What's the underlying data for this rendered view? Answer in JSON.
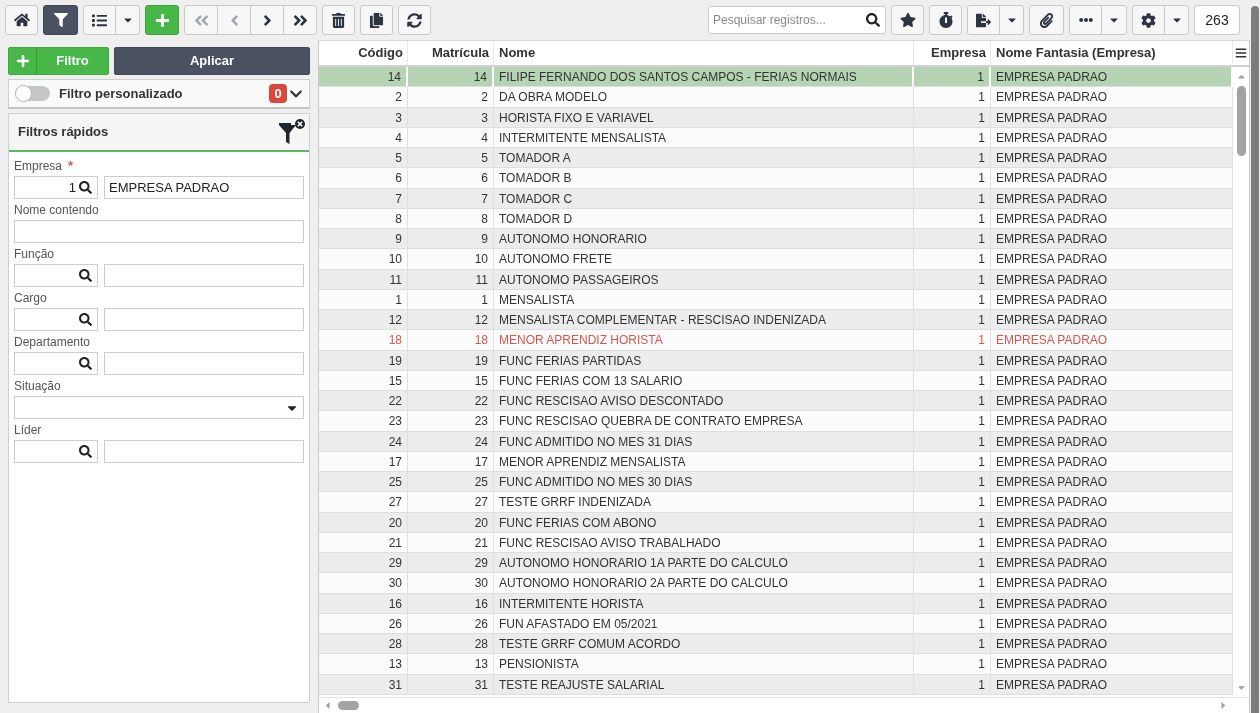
{
  "toolbar": {
    "filter_button": {
      "selected": true
    },
    "navigation": [
      {
        "disabled": true
      },
      {
        "disabled": true
      },
      {
        "disabled": false
      },
      {
        "disabled": false
      }
    ],
    "search": {
      "placeholder": "Pesquisar registros..."
    },
    "record_count": "263"
  },
  "filter_panel": {
    "add_filter_button": "Filtro",
    "apply_button": "Aplicar",
    "custom_filter": {
      "label": "Filtro personalizado",
      "on": false,
      "count": "0"
    },
    "quick_filters": {
      "title": "Filtros rápidos",
      "fields": [
        {
          "kind": "lookup",
          "label": "Empresa",
          "required_mark": "*",
          "code": "1",
          "value": "EMPRESA PADRAO"
        },
        {
          "kind": "text",
          "label": "Nome contendo"
        },
        {
          "kind": "lookup",
          "label": "Função"
        },
        {
          "kind": "lookup",
          "label": "Cargo"
        },
        {
          "kind": "lookup",
          "label": "Departamento"
        },
        {
          "kind": "select",
          "label": "Situação"
        },
        {
          "kind": "lookup",
          "label": "Líder"
        }
      ]
    }
  },
  "table": {
    "columns": [
      "Código",
      "Matrícula",
      "Nome",
      "Empresa",
      "Nome Fantasia (Empresa)"
    ],
    "rows": [
      {
        "cells": [
          "14",
          "14",
          "FILIPE FERNANDO DOS SANTOS CAMPOS - FERIAS NORMAIS",
          "1",
          "EMPRESA PADRAO"
        ],
        "selected": true,
        "flagged": false
      },
      {
        "cells": [
          "2",
          "2",
          "DA OBRA MODELO",
          "1",
          "EMPRESA PADRAO"
        ],
        "selected": false,
        "flagged": false
      },
      {
        "cells": [
          "3",
          "3",
          "HORISTA FIXO E VARIAVEL",
          "1",
          "EMPRESA PADRAO"
        ],
        "selected": false,
        "flagged": false
      },
      {
        "cells": [
          "4",
          "4",
          "INTERMITENTE MENSALISTA",
          "1",
          "EMPRESA PADRAO"
        ],
        "selected": false,
        "flagged": false
      },
      {
        "cells": [
          "5",
          "5",
          "TOMADOR A",
          "1",
          "EMPRESA PADRAO"
        ],
        "selected": false,
        "flagged": false
      },
      {
        "cells": [
          "6",
          "6",
          "TOMADOR B",
          "1",
          "EMPRESA PADRAO"
        ],
        "selected": false,
        "flagged": false
      },
      {
        "cells": [
          "7",
          "7",
          "TOMADOR C",
          "1",
          "EMPRESA PADRAO"
        ],
        "selected": false,
        "flagged": false
      },
      {
        "cells": [
          "8",
          "8",
          "TOMADOR D",
          "1",
          "EMPRESA PADRAO"
        ],
        "selected": false,
        "flagged": false
      },
      {
        "cells": [
          "9",
          "9",
          "AUTONOMO HONORARIO",
          "1",
          "EMPRESA PADRAO"
        ],
        "selected": false,
        "flagged": false
      },
      {
        "cells": [
          "10",
          "10",
          "AUTONOMO FRETE",
          "1",
          "EMPRESA PADRAO"
        ],
        "selected": false,
        "flagged": false
      },
      {
        "cells": [
          "11",
          "11",
          "AUTONOMO PASSAGEIROS",
          "1",
          "EMPRESA PADRAO"
        ],
        "selected": false,
        "flagged": false
      },
      {
        "cells": [
          "1",
          "1",
          "MENSALISTA",
          "1",
          "EMPRESA PADRAO"
        ],
        "selected": false,
        "flagged": false
      },
      {
        "cells": [
          "12",
          "12",
          "MENSALISTA COMPLEMENTAR - RESCISAO INDENIZADA",
          "1",
          "EMPRESA PADRAO"
        ],
        "selected": false,
        "flagged": false
      },
      {
        "cells": [
          "18",
          "18",
          "MENOR APRENDIZ HORISTA",
          "1",
          "EMPRESA PADRAO"
        ],
        "selected": false,
        "flagged": true
      },
      {
        "cells": [
          "19",
          "19",
          "FUNC FERIAS PARTIDAS",
          "1",
          "EMPRESA PADRAO"
        ],
        "selected": false,
        "flagged": false
      },
      {
        "cells": [
          "15",
          "15",
          "FUNC FERIAS COM 13 SALARIO",
          "1",
          "EMPRESA PADRAO"
        ],
        "selected": false,
        "flagged": false
      },
      {
        "cells": [
          "22",
          "22",
          "FUNC RESCISAO AVISO DESCONTADO",
          "1",
          "EMPRESA PADRAO"
        ],
        "selected": false,
        "flagged": false
      },
      {
        "cells": [
          "23",
          "23",
          "FUNC RESCISAO QUEBRA DE CONTRATO EMPRESA",
          "1",
          "EMPRESA PADRAO"
        ],
        "selected": false,
        "flagged": false
      },
      {
        "cells": [
          "24",
          "24",
          "FUNC ADMITIDO NO MES 31 DIAS",
          "1",
          "EMPRESA PADRAO"
        ],
        "selected": false,
        "flagged": false
      },
      {
        "cells": [
          "17",
          "17",
          "MENOR APRENDIZ MENSALISTA",
          "1",
          "EMPRESA PADRAO"
        ],
        "selected": false,
        "flagged": false
      },
      {
        "cells": [
          "25",
          "25",
          "FUNC ADMITIDO NO MES 30 DIAS",
          "1",
          "EMPRESA PADRAO"
        ],
        "selected": false,
        "flagged": false
      },
      {
        "cells": [
          "27",
          "27",
          "TESTE GRRF INDENIZADA",
          "1",
          "EMPRESA PADRAO"
        ],
        "selected": false,
        "flagged": false
      },
      {
        "cells": [
          "20",
          "20",
          "FUNC FERIAS COM ABONO",
          "1",
          "EMPRESA PADRAO"
        ],
        "selected": false,
        "flagged": false
      },
      {
        "cells": [
          "21",
          "21",
          "FUNC RESCISAO AVISO TRABALHADO",
          "1",
          "EMPRESA PADRAO"
        ],
        "selected": false,
        "flagged": false
      },
      {
        "cells": [
          "29",
          "29",
          "AUTONOMO HONORARIO 1A PARTE DO CALCULO",
          "1",
          "EMPRESA PADRAO"
        ],
        "selected": false,
        "flagged": false
      },
      {
        "cells": [
          "30",
          "30",
          "AUTONOMO HONORARIO 2A PARTE DO CALCULO",
          "1",
          "EMPRESA PADRAO"
        ],
        "selected": false,
        "flagged": false
      },
      {
        "cells": [
          "16",
          "16",
          "INTERMITENTE HORISTA",
          "1",
          "EMPRESA PADRAO"
        ],
        "selected": false,
        "flagged": false
      },
      {
        "cells": [
          "26",
          "26",
          "FUN AFASTADO EM 05/2021",
          "1",
          "EMPRESA PADRAO"
        ],
        "selected": false,
        "flagged": false
      },
      {
        "cells": [
          "28",
          "28",
          "TESTE GRRF COMUM ACORDO",
          "1",
          "EMPRESA PADRAO"
        ],
        "selected": false,
        "flagged": false
      },
      {
        "cells": [
          "13",
          "13",
          "PENSIONISTA",
          "1",
          "EMPRESA PADRAO"
        ],
        "selected": false,
        "flagged": false
      },
      {
        "cells": [
          "31",
          "31",
          "TESTE REAJUSTE SALARIAL",
          "1",
          "EMPRESA PADRAO"
        ],
        "selected": false,
        "flagged": false
      }
    ]
  }
}
